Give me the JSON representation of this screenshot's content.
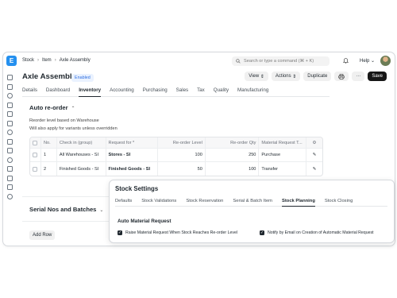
{
  "app": {
    "logo": "E"
  },
  "breadcrumb": [
    "Stock",
    "Item",
    "Axle Assembly"
  ],
  "search": {
    "placeholder": "Search or type a command (⌘ + K)"
  },
  "help_label": "Help",
  "doc": {
    "title": "Axle Assembly",
    "status": "Enabled"
  },
  "toolbar": {
    "view": "View",
    "actions": "Actions",
    "duplicate": "Duplicate",
    "more": "···",
    "save": "Save"
  },
  "tabs": [
    "Details",
    "Dashboard",
    "Inventory",
    "Accounting",
    "Purchasing",
    "Sales",
    "Tax",
    "Quality",
    "Manufacturing"
  ],
  "active_tab": "Inventory",
  "auto_reorder": {
    "title": "Auto re-order",
    "desc1": "Reorder level based on Warehouse",
    "desc2": "Will also apply for variants unless overridden",
    "columns": [
      "No.",
      "Check in (group)",
      "Request for *",
      "Re-order Level",
      "Re-order Qty",
      "Material Request T..."
    ],
    "rows": [
      {
        "no": "1",
        "check_in": "All Warehouses - SI",
        "request_for": "Stores - SI",
        "level": "100",
        "qty": "250",
        "type": "Purchase"
      },
      {
        "no": "2",
        "check_in": "Finished Goods - SI",
        "request_for": "Finished Goods - SI",
        "level": "50",
        "qty": "100",
        "type": "Transfer"
      }
    ],
    "add_row": "Add Row"
  },
  "serial_section": {
    "title": "Serial Nos and Batches"
  },
  "stock_settings": {
    "title": "Stock Settings",
    "tabs": [
      "Defaults",
      "Stock Validations",
      "Stock Reservation",
      "Serial & Batch Item",
      "Stock Planning",
      "Stock Closing"
    ],
    "active_tab": "Stock Planning",
    "section": "Auto Material Request",
    "check1": "Raise Material Request When Stock Reaches Re-order Level",
    "check2": "Notify by Email on Creation of Automatic Material Request"
  },
  "colors": {
    "accent": "#2490ef",
    "badge_bg": "#eaf2ff",
    "badge_text": "#2f6fe0",
    "save_bg": "#171717"
  }
}
